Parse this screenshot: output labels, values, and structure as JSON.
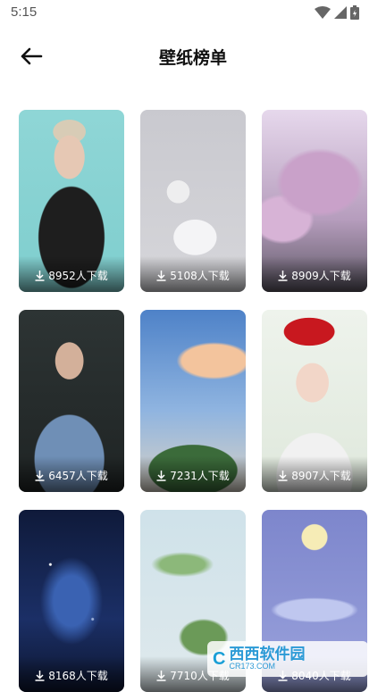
{
  "status_bar": {
    "time": "5:15",
    "icons": [
      "wifi-icon",
      "signal-icon",
      "battery-icon"
    ]
  },
  "header": {
    "title": "壁纸榜单",
    "back_icon": "arrow-left-icon"
  },
  "wallpapers": [
    {
      "downloads": "8952人下载"
    },
    {
      "downloads": "5108人下载"
    },
    {
      "downloads": "8909人下载"
    },
    {
      "downloads": "6457人下载"
    },
    {
      "downloads": "7231人下载"
    },
    {
      "downloads": "8907人下载"
    },
    {
      "downloads": "8168人下载"
    },
    {
      "downloads": "7710人下载"
    },
    {
      "downloads": "8040人下载"
    }
  ],
  "watermark": {
    "logo": "C",
    "main": "西西软件园",
    "sub": "CR173.COM"
  },
  "colors": {
    "background": "#ffffff",
    "title": "#111111",
    "overlay_text": "#ffffff"
  }
}
